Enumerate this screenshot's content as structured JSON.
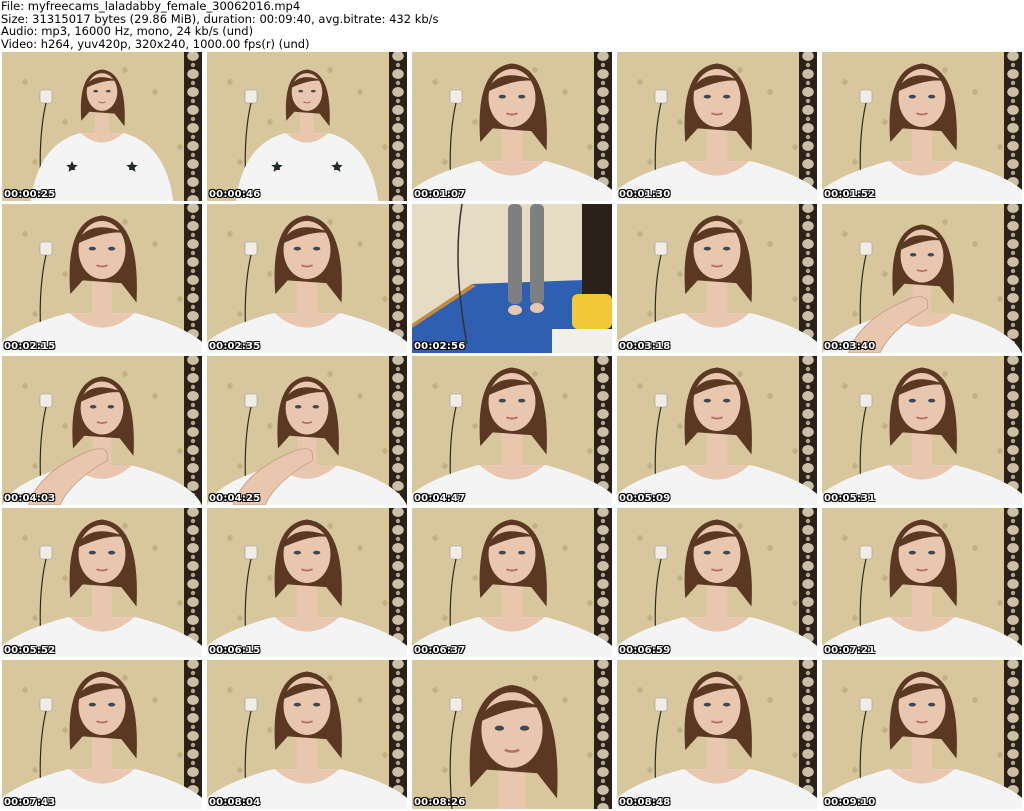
{
  "header": {
    "file_line": "File: myfreecams_laladabby_female_30062016.mp4",
    "size_line": "Size: 31315017 bytes (29.86 MiB), duration: 00:09:40, avg.bitrate: 432 kb/s",
    "audio_line": "Audio: mp3, 16000 Hz, mono, 24 kb/s (und)",
    "video_line": "Video: h264, yuv420p, 320x240, 1000.00 fps(r) (und)"
  },
  "thumbnails": [
    {
      "timestamp": "00:00:25",
      "scene": "wide"
    },
    {
      "timestamp": "00:00:46",
      "scene": "wide"
    },
    {
      "timestamp": "00:01:07",
      "scene": "closeup"
    },
    {
      "timestamp": "00:01:30",
      "scene": "closeup"
    },
    {
      "timestamp": "00:01:52",
      "scene": "closeup"
    },
    {
      "timestamp": "00:02:15",
      "scene": "closeup"
    },
    {
      "timestamp": "00:02:35",
      "scene": "closeup"
    },
    {
      "timestamp": "00:02:56",
      "scene": "floor"
    },
    {
      "timestamp": "00:03:18",
      "scene": "closeup"
    },
    {
      "timestamp": "00:03:40",
      "scene": "hand"
    },
    {
      "timestamp": "00:04:03",
      "scene": "hand"
    },
    {
      "timestamp": "00:04:25",
      "scene": "hand"
    },
    {
      "timestamp": "00:04:47",
      "scene": "closeup"
    },
    {
      "timestamp": "00:05:09",
      "scene": "closeup"
    },
    {
      "timestamp": "00:05:31",
      "scene": "closeup"
    },
    {
      "timestamp": "00:05:52",
      "scene": "closeup"
    },
    {
      "timestamp": "00:06:15",
      "scene": "closeup"
    },
    {
      "timestamp": "00:06:37",
      "scene": "closeup"
    },
    {
      "timestamp": "00:06:59",
      "scene": "closeup"
    },
    {
      "timestamp": "00:07:21",
      "scene": "closeup"
    },
    {
      "timestamp": "00:07:43",
      "scene": "closeup"
    },
    {
      "timestamp": "00:08:04",
      "scene": "closeup"
    },
    {
      "timestamp": "00:08:26",
      "scene": "near"
    },
    {
      "timestamp": "00:08:48",
      "scene": "closeup"
    },
    {
      "timestamp": "00:09:10",
      "scene": "closeup"
    }
  ],
  "colors": {
    "wall": "#d8c79c",
    "wallpaper_dark": "#2b2118",
    "wallpaper_light": "#e8dcc0",
    "skin": "#e9c7ae",
    "hair": "#5a3822",
    "shirt": "#f4f4f4",
    "star": "#1f2a2a",
    "carpet": "#2f5fb0",
    "leggings": "#7d7f80"
  }
}
